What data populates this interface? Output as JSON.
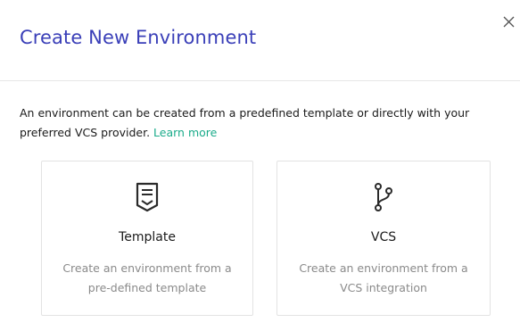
{
  "modal": {
    "title": "Create New Environment",
    "close_icon": "close-icon"
  },
  "description": {
    "text": "An environment can be created from a predefined template or directly with your preferred VCS provider.",
    "link_label": "Learn more"
  },
  "cards": [
    {
      "icon": "template-document-icon",
      "title": "Template",
      "description": "Create an environment from a pre-defined template"
    },
    {
      "icon": "git-branch-icon",
      "title": "VCS",
      "description": "Create an environment from a VCS integration"
    }
  ],
  "colors": {
    "title": "#3a3fb8",
    "link": "#1aab8a",
    "muted_text": "#8a8a8a",
    "border": "#e3e3e3"
  }
}
